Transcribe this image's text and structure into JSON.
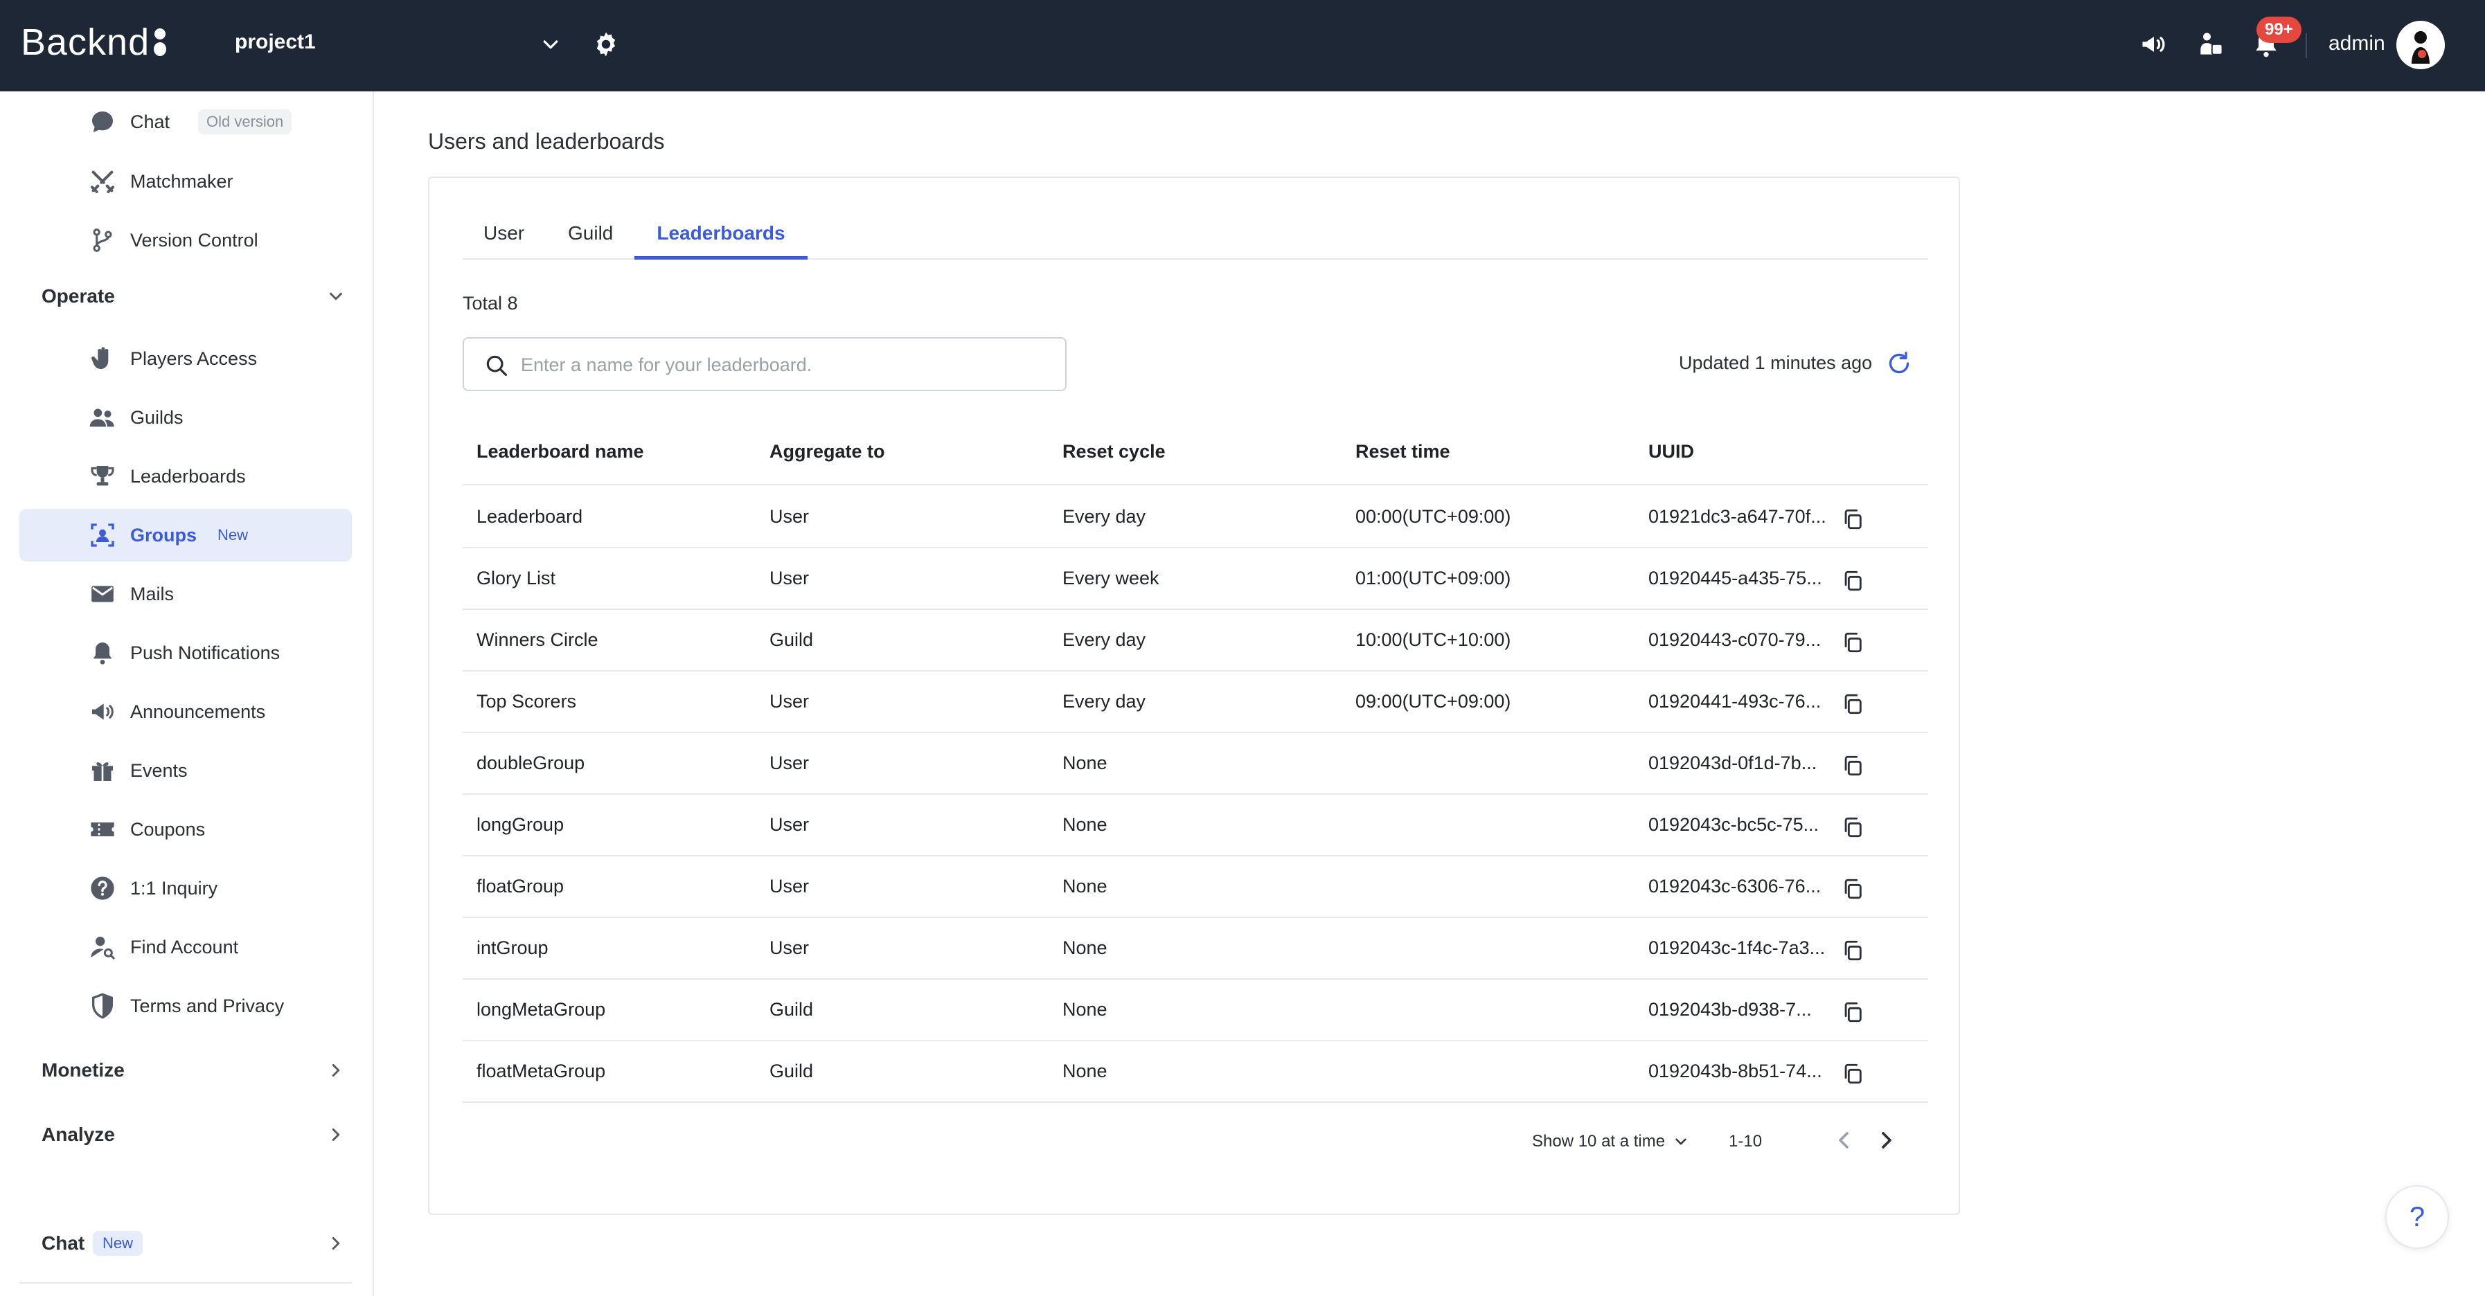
{
  "topbar": {
    "logo_text": "Backnd",
    "project_name": "project1",
    "badge_count": "99+",
    "admin_name": "admin"
  },
  "sidebar": {
    "chat_old": {
      "label": "Chat",
      "tag": "Old version"
    },
    "matchmaker": "Matchmaker",
    "version_control": "Version Control",
    "operate_section": "Operate",
    "operate_items": [
      {
        "label": "Players Access",
        "icon": "hand-icon"
      },
      {
        "label": "Guilds",
        "icon": "people-icon"
      },
      {
        "label": "Leaderboards",
        "icon": "trophy-icon"
      },
      {
        "label": "Groups",
        "icon": "group-icon",
        "tag": "New"
      },
      {
        "label": "Mails",
        "icon": "mail-icon"
      },
      {
        "label": "Push Notifications",
        "icon": "bell-icon"
      },
      {
        "label": "Announcements",
        "icon": "megaphone-icon"
      },
      {
        "label": "Events",
        "icon": "gift-icon"
      },
      {
        "label": "Coupons",
        "icon": "ticket-icon"
      },
      {
        "label": "1:1 Inquiry",
        "icon": "question-icon"
      },
      {
        "label": "Find Account",
        "icon": "user-search-icon"
      },
      {
        "label": "Terms and Privacy",
        "icon": "shield-icon"
      }
    ],
    "monetize_section": "Monetize",
    "analyze_section": "Analyze",
    "chat_section": {
      "label": "Chat",
      "tag": "New"
    }
  },
  "main": {
    "page_title": "Users and leaderboards",
    "tabs": [
      {
        "label": "User"
      },
      {
        "label": "Guild"
      },
      {
        "label": "Leaderboards"
      }
    ],
    "total": "Total 8",
    "search": {
      "placeholder": "Enter a name for your leaderboard.",
      "value": ""
    },
    "updated": "Updated 1 minutes ago",
    "columns": [
      "Leaderboard name",
      "Aggregate to",
      "Reset cycle",
      "Reset time",
      "UUID"
    ],
    "rows": [
      [
        "Leaderboard",
        "User",
        "Every day",
        "00:00(UTC+09:00)",
        "01921dc3-a647-70f..."
      ],
      [
        "Glory List",
        "User",
        "Every week",
        "01:00(UTC+09:00)",
        "01920445-a435-75..."
      ],
      [
        "Winners Circle",
        "Guild",
        "Every day",
        "10:00(UTC+10:00)",
        "01920443-c070-79..."
      ],
      [
        "Top Scorers",
        "User",
        "Every day",
        "09:00(UTC+09:00)",
        "01920441-493c-76..."
      ],
      [
        "doubleGroup",
        "User",
        "None",
        "",
        "0192043d-0f1d-7b..."
      ],
      [
        "longGroup",
        "User",
        "None",
        "",
        "0192043c-bc5c-75..."
      ],
      [
        "floatGroup",
        "User",
        "None",
        "",
        "0192043c-6306-76..."
      ],
      [
        "intGroup",
        "User",
        "None",
        "",
        "0192043c-1f4c-7a3..."
      ],
      [
        "longMetaGroup",
        "Guild",
        "None",
        "",
        "0192043b-d938-7..."
      ],
      [
        "floatMetaGroup",
        "Guild",
        "None",
        "",
        "0192043b-8b51-74..."
      ]
    ],
    "pagination": {
      "page_size_label": "Show 10 at a time",
      "range": "1-10"
    },
    "help_label": "?"
  },
  "colors": {
    "topbar": "#1e2736",
    "accent": "#3b5bdb",
    "badge": "#e5483f",
    "active_bg": "#e7ecfb"
  }
}
